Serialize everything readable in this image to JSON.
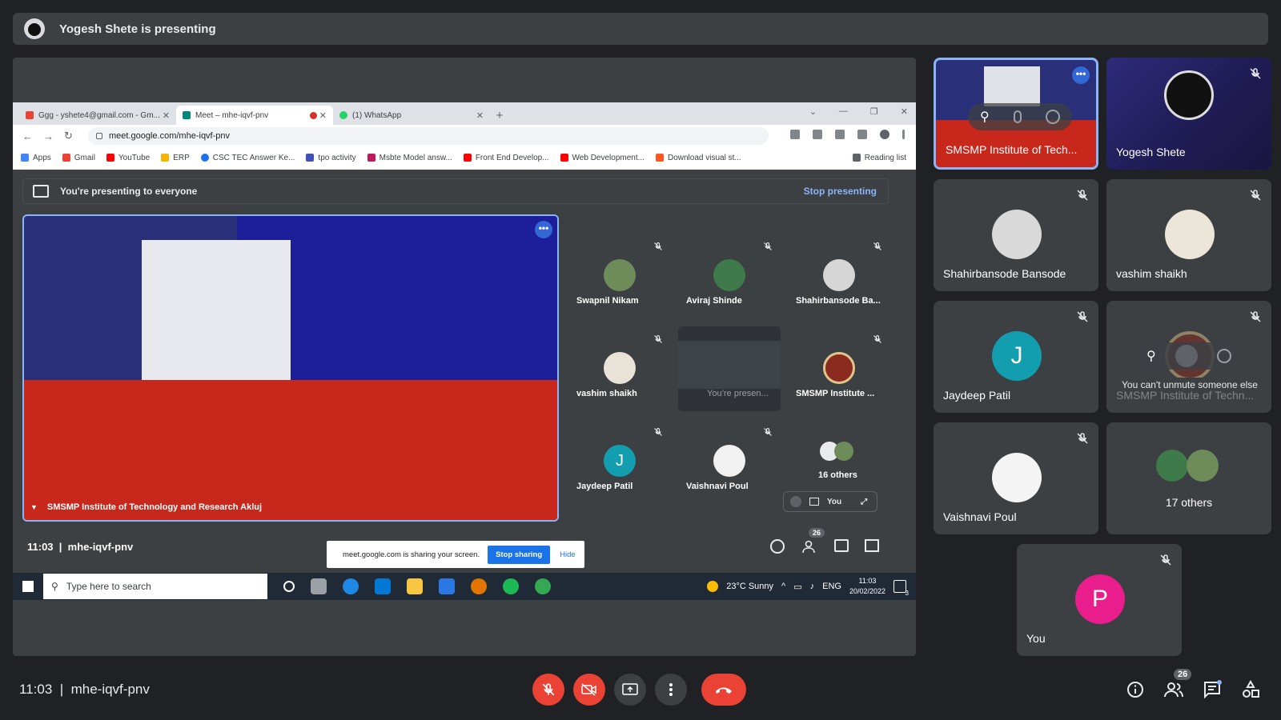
{
  "banner": {
    "text": "Yogesh Shete is presenting"
  },
  "browser": {
    "tabs": [
      {
        "label": "Ggg - yshete4@gmail.com - Gm...",
        "color": "#ea4335"
      },
      {
        "label": "Meet – mhe-iqvf-pnv",
        "color": "#00897b"
      },
      {
        "label": "(1) WhatsApp",
        "color": "#25d366"
      }
    ],
    "url": "meet.google.com/mhe-iqvf-pnv",
    "bookmarks": [
      "Apps",
      "Gmail",
      "YouTube",
      "ERP",
      "CSC TEC Answer Ke...",
      "tpo activity",
      "Msbte Model answ...",
      "Front End Develop...",
      "Web Development...",
      "Download visual st..."
    ],
    "reading_list": "Reading list"
  },
  "inner": {
    "presenting_text": "You're presenting to everyone",
    "stop_presenting": "Stop presenting",
    "main_label": "SMSMP Institute of Technology and Research Akluj",
    "tiles": [
      {
        "name": "Swapnil Nikam"
      },
      {
        "name": "Aviraj Shinde"
      },
      {
        "name": "Shahirbansode Ba..."
      },
      {
        "name": "vashim shaikh"
      },
      {
        "name": "You’re presen..."
      },
      {
        "name": "SMSMP Institute ..."
      },
      {
        "name": "Jaydeep Patil",
        "initial": "J"
      },
      {
        "name": "Vaishnavi Poul"
      },
      {
        "name": "16 others"
      }
    ],
    "self_label": "You",
    "time": "11:03",
    "meeting_code": "mhe-iqvf-pnv",
    "people_count": "26",
    "share_notice": "meet.google.com is sharing your screen.",
    "stop_sharing": "Stop sharing",
    "hide": "Hide",
    "taskbar": {
      "search_placeholder": "Type here to search",
      "weather": "23°C  Sunny",
      "lang": "ENG",
      "clock_time": "11:03",
      "clock_date": "20/02/2022",
      "notif_count": "3"
    }
  },
  "tiles": [
    {
      "name": "SMSMP Institute of Tech..."
    },
    {
      "name": "Yogesh Shete"
    },
    {
      "name": "Shahirbansode Bansode"
    },
    {
      "name": "vashim shaikh"
    },
    {
      "name": "Jaydeep Patil",
      "initial": "J"
    },
    {
      "name": "SMSMP Institute of Techn...",
      "tooltip": "You can't unmute someone else"
    },
    {
      "name": "Vaishnavi Poul"
    },
    {
      "name": "17 others"
    },
    {
      "name": "You",
      "initial": "P"
    }
  ],
  "bottom": {
    "time": "11:03",
    "meeting_code": "mhe-iqvf-pnv",
    "people_count": "26"
  },
  "colors": {
    "accent": "#8ab4f8",
    "danger": "#ea4335",
    "jaydeep": "#129eaf",
    "you": "#e91e8c"
  }
}
